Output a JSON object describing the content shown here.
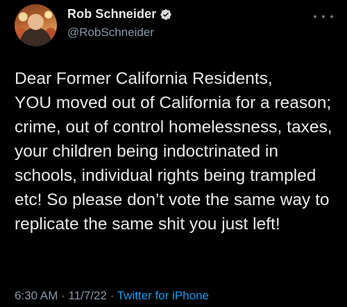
{
  "tweet": {
    "author": {
      "display_name": "Rob Schneider",
      "handle": "@RobSchneider",
      "verified": true,
      "avatar_icon": "profile-photo"
    },
    "more_icon": "ellipsis-icon",
    "text": "Dear Former California Residents,\nYOU moved out of California for a reason; crime, out of control homelessness, taxes, your children being indoctrinated in schools, individual rights being trampled etc! So please don’t vote the same way to replicate the same shit you just left!",
    "time": "6:30 AM",
    "date": "11/7/22",
    "separator": "·",
    "source": "Twitter for iPhone"
  },
  "colors": {
    "background": "#000000",
    "text": "#e7e9ea",
    "secondary": "#8b98a5",
    "link": "#1d9bf0",
    "verified_badge": "#d9d9d9"
  }
}
